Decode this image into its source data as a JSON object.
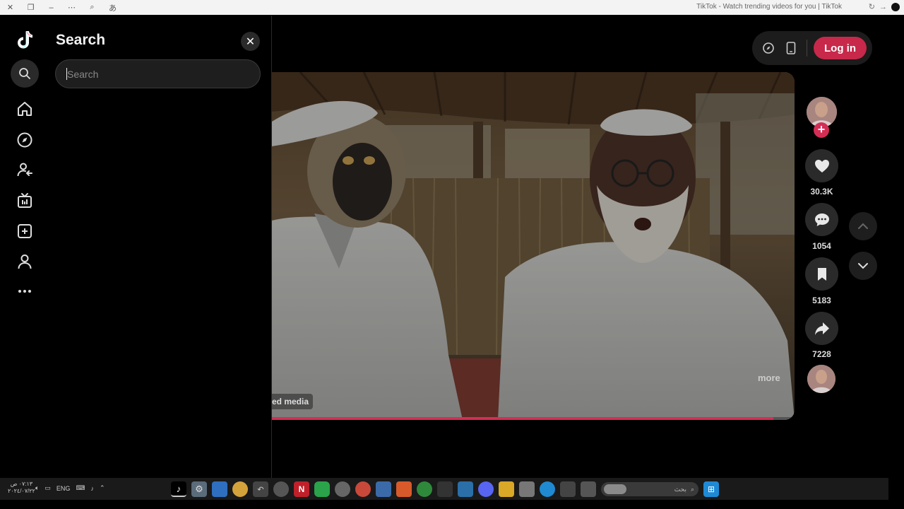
{
  "browser": {
    "window_title": "TikTok - Watch trending videos for you | TikTok"
  },
  "search_panel": {
    "title": "Search",
    "placeholder": "Search",
    "close_label": "✕"
  },
  "left_nav": {
    "items": [
      {
        "name": "home",
        "icon": "home-icon"
      },
      {
        "name": "explore",
        "icon": "compass-icon"
      },
      {
        "name": "following",
        "icon": "user-follow-icon"
      },
      {
        "name": "live",
        "icon": "tv-icon"
      },
      {
        "name": "upload",
        "icon": "plus-square-icon"
      },
      {
        "name": "profile",
        "icon": "user-icon"
      },
      {
        "name": "more",
        "icon": "more-dots-icon"
      }
    ]
  },
  "top_actions": {
    "login_label": "Log in",
    "login_color": "#c8284a"
  },
  "video": {
    "tag_text": "ed media",
    "more_text": "more",
    "progress": 0.96
  },
  "rail": {
    "likes": "30.3K",
    "comments": "1054",
    "bookmarks": "5183",
    "shares": "7228"
  },
  "taskbar": {
    "clock_line1": "٠٧:١٣ ص",
    "clock_line2": "٢٠٢٤/٠٧/٢٢",
    "lang": "ENG",
    "search_text": "بحث"
  }
}
